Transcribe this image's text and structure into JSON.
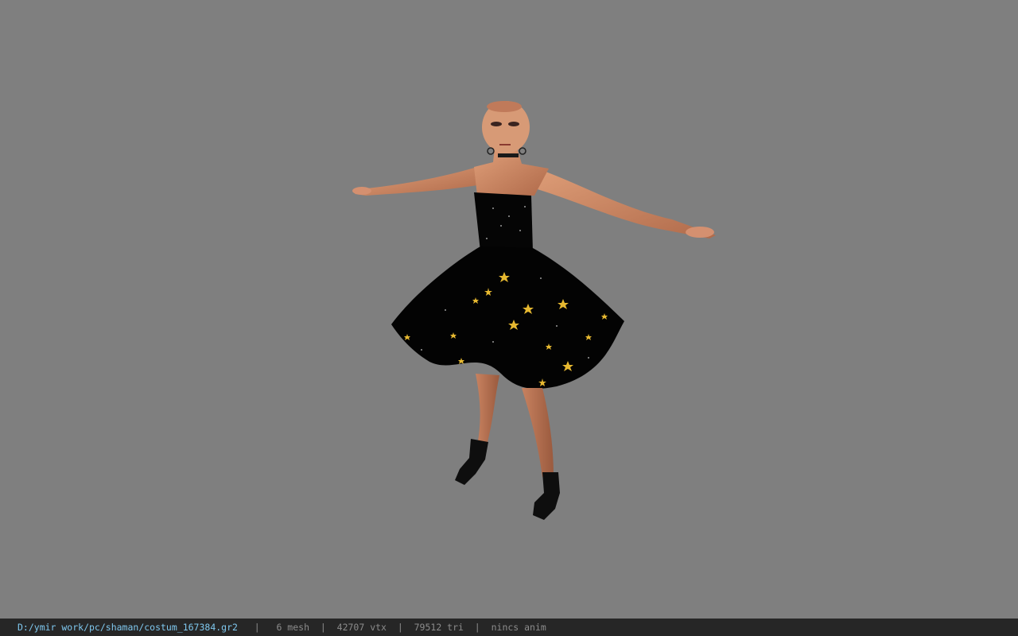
{
  "viewport": {
    "background": "#7f7f7f"
  },
  "status_bar": {
    "file_path": "D:/ymir work/pc/shaman/costum_167384.gr2",
    "separator": "|",
    "mesh_count": "6 mesh",
    "vertex_count": "42707 vtx",
    "triangle_count": "79512 tri",
    "anim_status": "nincs anim",
    "path_color": "#7fc8ef",
    "text_color": "#8c8c8c",
    "background": "#262626"
  }
}
